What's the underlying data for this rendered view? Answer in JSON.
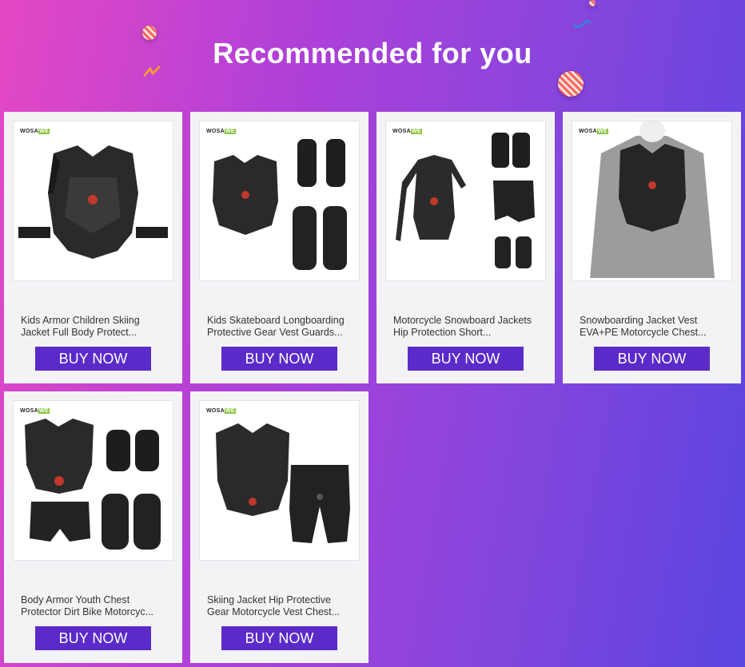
{
  "header": {
    "title": "Recommended for you"
  },
  "products": [
    {
      "brand_logo": "WOSAWE",
      "name": "Kids Armor Children Skiing Jacket Full Body Protect...",
      "button": "BUY NOW"
    },
    {
      "brand_logo": "WOSAWE",
      "name": "Kids Skateboard Longboarding Protective Gear Vest Guards...",
      "button": "BUY NOW"
    },
    {
      "brand_logo": "WOSAWE",
      "name": "Motorcycle Snowboard Jackets Hip Protection Short...",
      "button": "BUY NOW"
    },
    {
      "brand_logo": "WOSAWE",
      "name": "Snowboarding Jacket Vest EVA+PE Motorcycle Chest...",
      "button": "BUY NOW"
    },
    {
      "brand_logo": "WOSAWE",
      "name": "Body Armor Youth Chest Protector Dirt Bike Motorcyc...",
      "button": "BUY NOW"
    },
    {
      "brand_logo": "WOSAWE",
      "name": "Skiing Jacket Hip Protective Gear Motorcycle Vest Chest...",
      "button": "BUY NOW"
    }
  ],
  "colors": {
    "button": "#5b2bc9",
    "card": "#f3f3f6",
    "gradient_start": "#e548c4",
    "gradient_end": "#5a45e0"
  }
}
